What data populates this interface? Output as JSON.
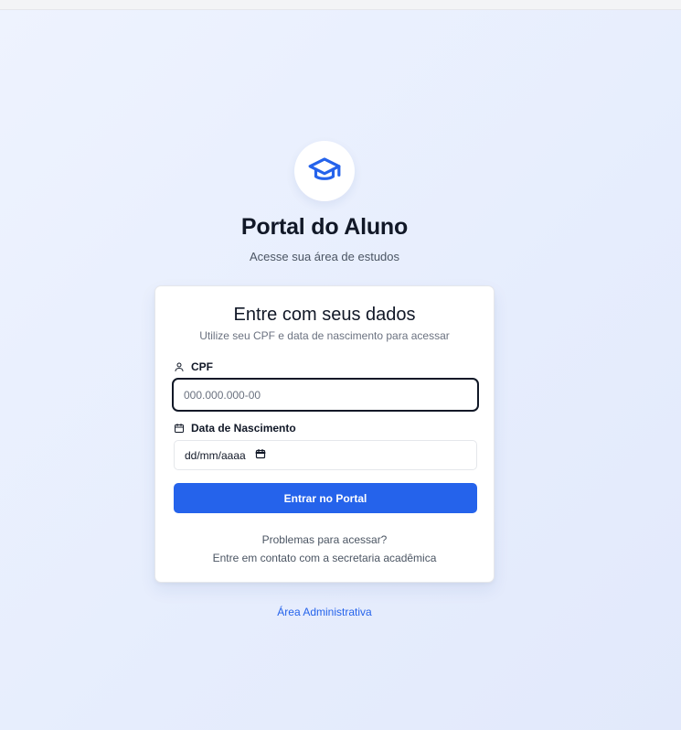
{
  "header": {
    "title": "Portal do Aluno",
    "subtitle": "Acesse sua área de estudos",
    "logo_icon": "graduation-cap-icon"
  },
  "login_card": {
    "title": "Entre com seus dados",
    "subtitle": "Utilize seu CPF e data de nascimento para acessar",
    "cpf": {
      "label": "CPF",
      "icon": "user-icon",
      "placeholder": "000.000.000-00",
      "value": ""
    },
    "birth_date": {
      "label": "Data de Nascimento",
      "icon": "calendar-icon",
      "placeholder": "dd/mm/aaaa"
    },
    "submit_label": "Entrar no Portal",
    "help_title": "Problemas para acessar?",
    "help_text": "Entre em contato com a secretaria acadêmica"
  },
  "footer": {
    "admin_link": "Área Administrativa"
  },
  "colors": {
    "primary": "#2563eb",
    "background": "#e9effd",
    "text_dark": "#111827",
    "text_muted": "#6b7280"
  }
}
